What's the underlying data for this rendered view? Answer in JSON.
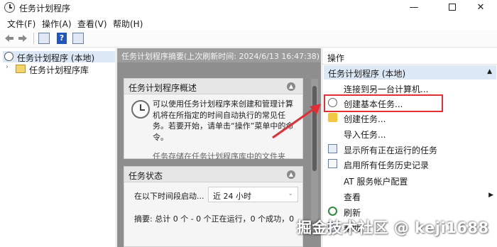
{
  "window": {
    "title": "任务计划程序",
    "minimize": "—",
    "close": "✕"
  },
  "menu": [
    "文件(F)",
    "操作(A)",
    "查看(V)",
    "帮助(H)"
  ],
  "toolbar": {
    "back_icon": "arrow-left-icon",
    "forward_icon": "arrow-right-icon",
    "help_label": "?"
  },
  "tree": {
    "root_label": "任务计划程序 (本地)",
    "child_label": "任务计划程序库",
    "chevron": "›"
  },
  "center": {
    "header": "任务计划程序摘要(上次刷新时间: 2024/6/13 16:47:38)",
    "overview": {
      "title": "任务计划程序概述",
      "text": "可以使用任务计划程序来创建和管理计算机将在所指定的时间自动执行的常见任务。若要开始，请单击“操作”菜单中的命令。",
      "text_faded": "任务存储在任务计划程序库中的文件夹"
    },
    "status": {
      "title": "任务状态",
      "label": "在以下时间段启动...",
      "select_value": "近 24 小时",
      "summary": "摘要: 总计 0 个 - 0 个正在运行，0 个成功，0"
    }
  },
  "actions": {
    "title": "操作",
    "group_label": "任务计划程序 (本地)",
    "items": [
      {
        "label": "连接到另一台计算机...",
        "icon": "none"
      },
      {
        "label": "创建基本任务...",
        "icon": "clock-icon"
      },
      {
        "label": "创建任务...",
        "icon": "wand-icon"
      },
      {
        "label": "导入任务...",
        "icon": "none"
      },
      {
        "label": "显示所有正在运行的任务",
        "icon": "list-icon"
      },
      {
        "label": "启用所有任务历史记录",
        "icon": "history-icon"
      },
      {
        "label": "AT 服务帐户配置",
        "icon": "none"
      },
      {
        "label": "查看",
        "icon": "none"
      },
      {
        "label": "刷新",
        "icon": "refresh-icon"
      },
      {
        "label": "帮助",
        "icon": "help-icon"
      }
    ]
  },
  "annotation": {
    "color": "#e03036"
  },
  "watermark": "掘金技术社区 @ keji1688"
}
